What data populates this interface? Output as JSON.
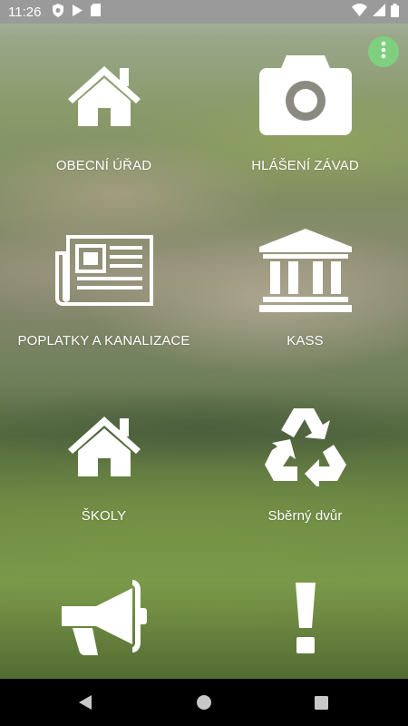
{
  "status_bar": {
    "time": "11:26",
    "left_icons": [
      "shield-icon",
      "play-icon",
      "sd-card-icon"
    ],
    "right_icons": [
      "wifi-icon",
      "signal-icon",
      "battery-icon"
    ]
  },
  "menu_button": {
    "icon": "more-vert-icon",
    "color": "#7ed07e"
  },
  "tiles": [
    {
      "label": "OBECNÍ ÚŘAD",
      "icon": "house-icon"
    },
    {
      "label": "HLÁŠENÍ ZÁVAD",
      "icon": "camera-icon"
    },
    {
      "label": "POPLATKY A KANALIZACE",
      "icon": "newspaper-icon"
    },
    {
      "label": "KASS",
      "icon": "bank-icon"
    },
    {
      "label": "ŠKOLY",
      "icon": "house-icon"
    },
    {
      "label": "Sběrný dvůr",
      "icon": "recycle-icon"
    },
    {
      "label": "",
      "icon": "megaphone-icon"
    },
    {
      "label": "",
      "icon": "exclamation-icon"
    }
  ],
  "nav_bar": [
    "back-icon",
    "home-icon",
    "recents-icon"
  ]
}
